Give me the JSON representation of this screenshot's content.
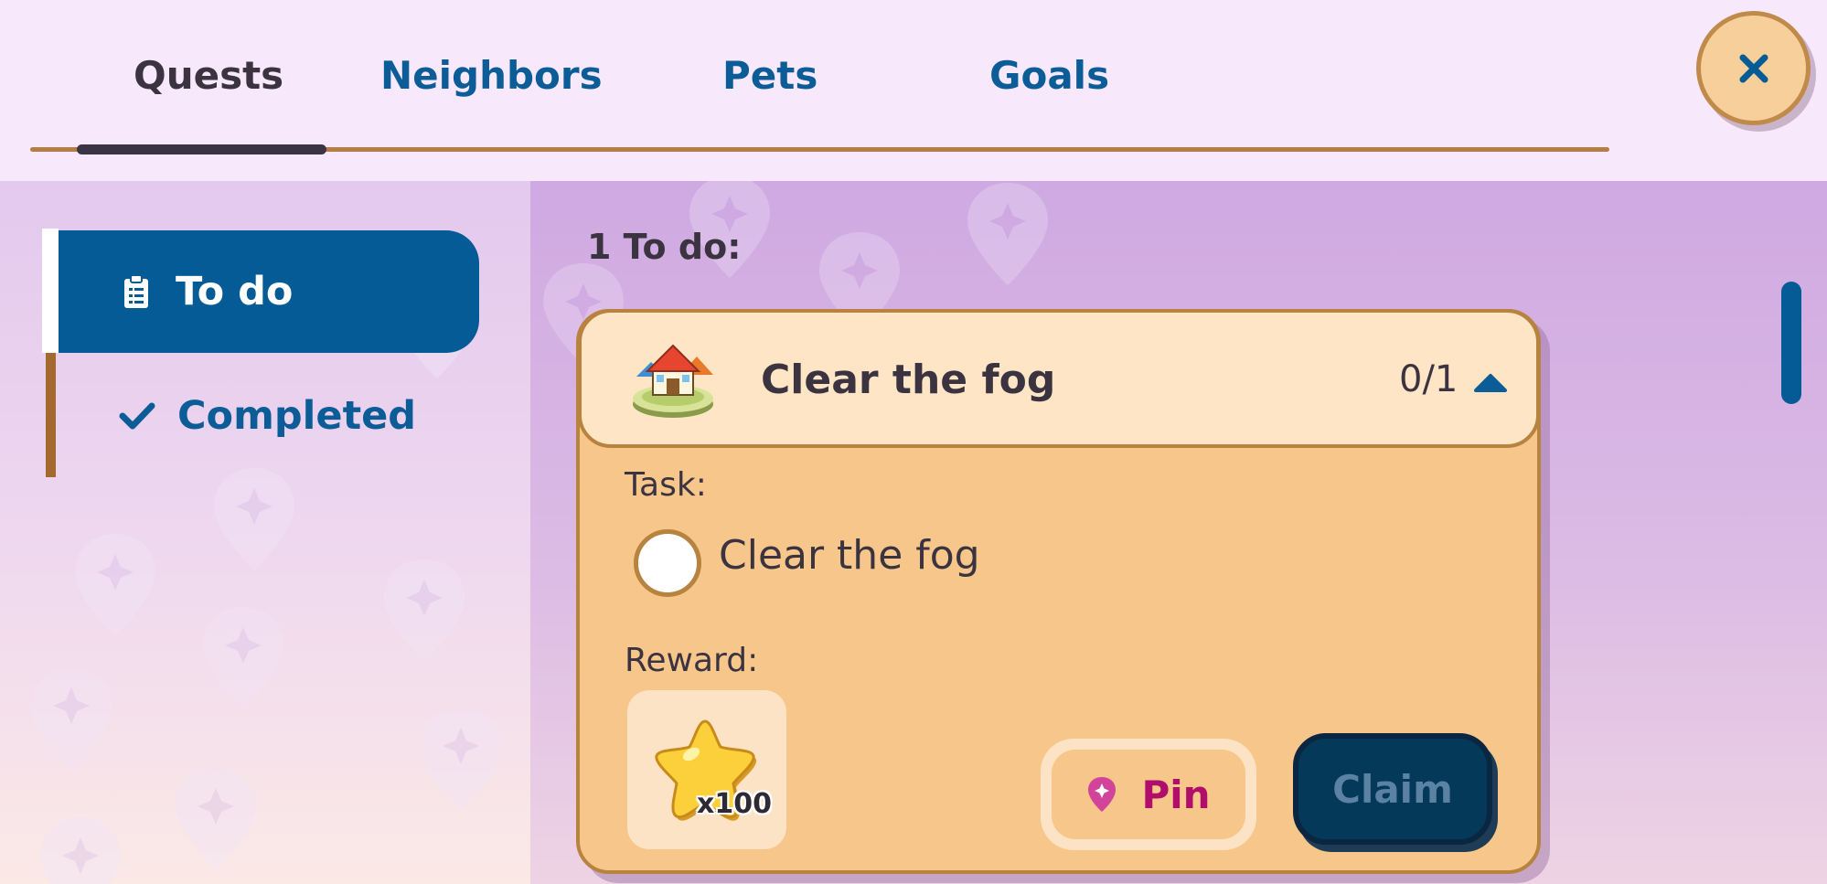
{
  "tabs": [
    {
      "label": "Quests",
      "active": true
    },
    {
      "label": "Neighbors",
      "active": false
    },
    {
      "label": "Pets",
      "active": false
    },
    {
      "label": "Goals",
      "active": false
    }
  ],
  "close": {
    "icon": "close-icon"
  },
  "sidebar": {
    "items": [
      {
        "label": "To do",
        "icon": "clipboard-icon",
        "selected": true
      },
      {
        "label": "Completed",
        "icon": "checkmark-icon",
        "selected": false
      }
    ]
  },
  "main": {
    "count_label": "1 To do:",
    "quest": {
      "title": "Clear the fog",
      "icon": "house-island-icon",
      "progress": "0/1",
      "expanded": true,
      "task_label": "Task:",
      "task_text": "Clear the fog",
      "task_done": false,
      "reward_label": "Reward:",
      "reward_icon": "star-icon",
      "reward_qty": "x100",
      "pin_label": "Pin",
      "claim_label": "Claim",
      "claim_enabled": false
    }
  },
  "colors": {
    "accent_blue": "#045b96",
    "header_bg": "#f7e9fb",
    "card_bg": "#f7c68a",
    "pin_text": "#b10d6a"
  }
}
